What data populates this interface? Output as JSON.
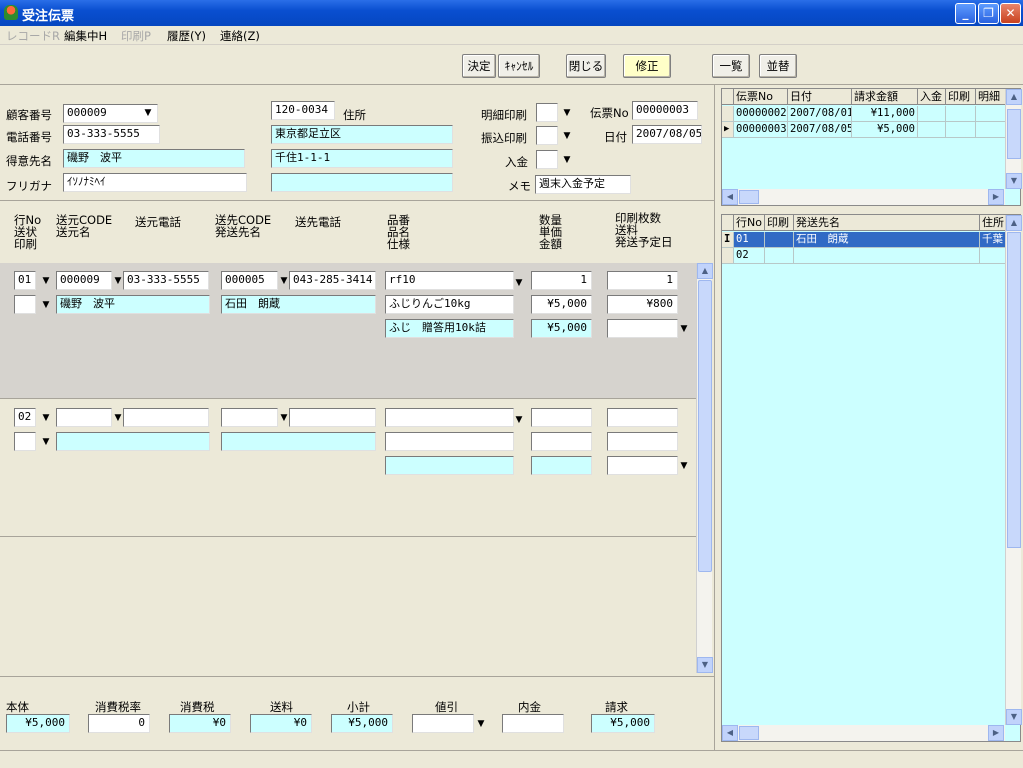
{
  "window": {
    "title": "受注伝票"
  },
  "menu": [
    "レコードR",
    "編集中H",
    "印刷P",
    "履歴(Y)",
    "連絡(Z)"
  ],
  "toolbar": {
    "decide": "決定",
    "cancel": "ｷｬﾝｾﾙ",
    "close": "閉じる",
    "edit": "修正",
    "list": "一覧",
    "sort": "並替"
  },
  "header": {
    "customer_no_label": "顧客番号",
    "customer_no": "000009",
    "phone_label": "電話番号",
    "phone": "03-333-5555",
    "client_label": "得意先名",
    "client": "磯野　波平",
    "kana_label": "フリガナ",
    "kana": "ｲｿﾉﾅﾐﾍｲ",
    "zip": "120-0034",
    "address_label": "住所",
    "address1": "東京都足立区",
    "address2": "千住1-1-1",
    "address3": "",
    "detail_print_label": "明細印刷",
    "transfer_print_label": "振込印刷",
    "payment_label": "入金",
    "slip_no_label": "伝票No",
    "slip_no": "00000003",
    "date_label": "日付",
    "date": "2007/08/05",
    "memo_label": "メモ",
    "memo": "週末入金予定"
  },
  "cols": {
    "c1": [
      "行No",
      "送状",
      "印刷"
    ],
    "c2": [
      "送元CODE",
      "送元名"
    ],
    "c3": "送元電話",
    "c4": [
      "送先CODE",
      "発送先名"
    ],
    "c5": "送先電話",
    "c6": [
      "品番",
      "品名",
      "仕様"
    ],
    "c7": [
      "数量",
      "単価",
      "金額"
    ],
    "c8": [
      "印刷枚数",
      "送料",
      "発送予定日"
    ]
  },
  "rows": [
    {
      "no": "01",
      "src_code": "000009",
      "src_tel": "03-333-5555",
      "dst_code": "000005",
      "dst_tel": "043-285-3414",
      "item_no": "rf10",
      "qty": "1",
      "prints": "1",
      "src_name": "磯野　波平",
      "dst_name": "石田　朗蔵",
      "item_name": "ふじりんご10kg",
      "price": "¥5,000",
      "shipping": "¥800",
      "spec": "ふじ　贈答用10k詰",
      "amount": "¥5,000"
    },
    {
      "no": "02",
      "src_code": "",
      "src_tel": "",
      "dst_code": "",
      "dst_tel": "",
      "item_no": "",
      "qty": "",
      "prints": "",
      "src_name": "",
      "dst_name": "",
      "item_name": "",
      "price": "",
      "shipping": "",
      "spec": "",
      "amount": ""
    }
  ],
  "totals": {
    "labels": [
      "本体",
      "消費税率",
      "消費税",
      "送料",
      "小計",
      "値引",
      "内金",
      "請求"
    ],
    "values": [
      "¥5,000",
      "0",
      "¥0",
      "¥0",
      "¥5,000",
      "",
      "",
      "¥5,000"
    ]
  },
  "slip_grid": {
    "headers": [
      "伝票No",
      "日付",
      "請求金額",
      "入金",
      "印刷",
      "明細"
    ],
    "rows": [
      [
        "00000002",
        "2007/08/01",
        "¥11,000",
        "",
        "",
        ""
      ],
      [
        "00000003",
        "2007/08/05",
        "¥5,000",
        "",
        "",
        ""
      ]
    ]
  },
  "dest_grid": {
    "headers": [
      "行No",
      "印刷",
      "発送先名",
      "住所"
    ],
    "rows": [
      [
        "01",
        "",
        "石田　朗蔵",
        "千葉"
      ],
      [
        "02",
        "",
        "",
        ""
      ]
    ]
  }
}
